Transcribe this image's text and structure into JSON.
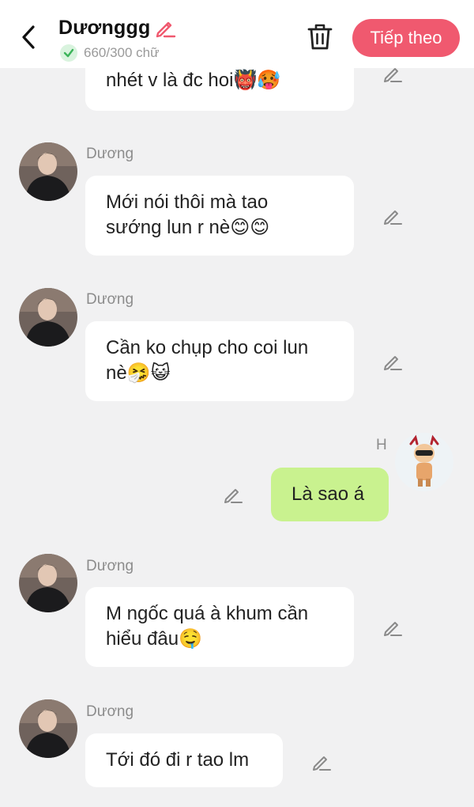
{
  "header": {
    "title": "Dươnggg",
    "count": "660/300 chữ",
    "next_label": "Tiếp theo"
  },
  "messages": [
    {
      "id": "m0",
      "side": "left",
      "text_lines": [
        "nhét v là đc hoi👹🥵"
      ]
    },
    {
      "id": "m1",
      "side": "left",
      "sender": "Dương",
      "text_lines": [
        "Mới nói thôi mà tao",
        "sướng lun r nè😊😊"
      ]
    },
    {
      "id": "m2",
      "side": "left",
      "sender": "Dương",
      "text_lines": [
        "Cần ko chụp cho coi lun",
        "nè🤧😺"
      ]
    },
    {
      "id": "m3",
      "side": "right",
      "sender": "H",
      "text_lines": [
        "Là sao á"
      ]
    },
    {
      "id": "m4",
      "side": "left",
      "sender": "Dương",
      "text_lines": [
        "M ngốc quá à khum cần",
        "hiểu đâu🤤"
      ]
    },
    {
      "id": "m5",
      "side": "left",
      "sender": "Dương",
      "text_lines": [
        "Tới đó đi r tao lm"
      ]
    }
  ],
  "icons": {
    "back": "chevron-left-icon",
    "title_edit": "pencil-icon",
    "check": "check-icon",
    "trash": "trash-icon",
    "message_edit": "pencil-icon"
  },
  "colors": {
    "accent": "#f0596f",
    "my_bubble": "#c9f28f",
    "background": "#f1f1f2"
  }
}
